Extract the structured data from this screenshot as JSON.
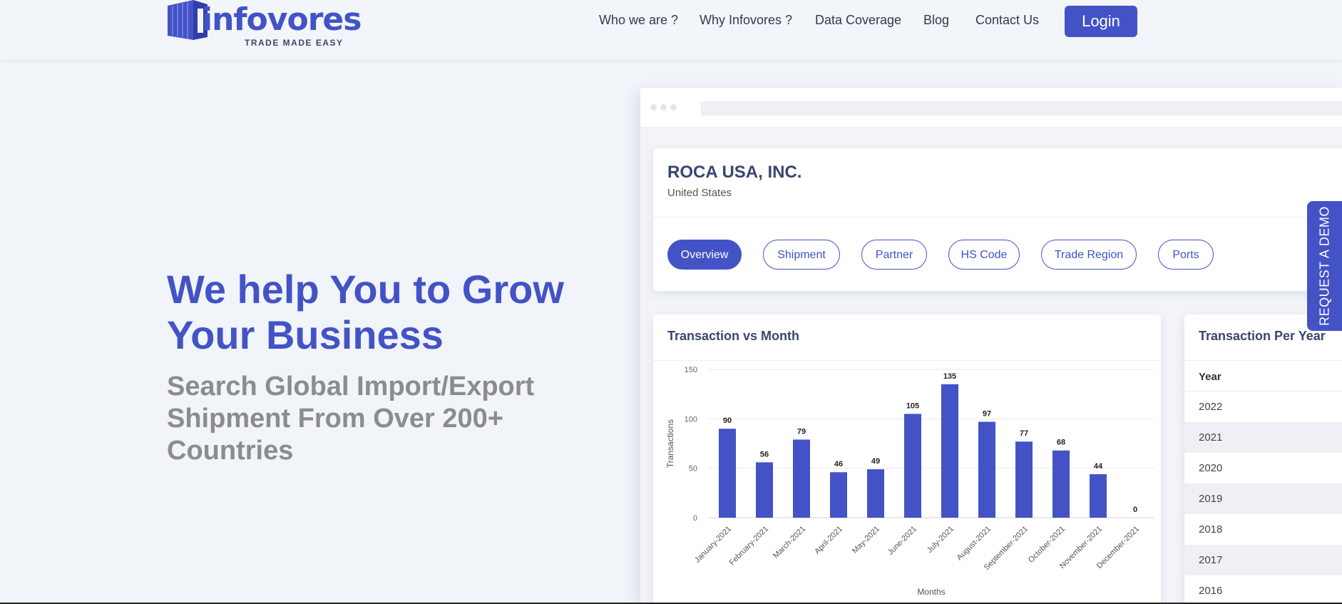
{
  "header": {
    "logo_text": "infovores",
    "logo_tagline": "TRADE MADE EASY",
    "nav": [
      "Who we are ?",
      "Why Infovores ?",
      "Data Coverage",
      "Blog",
      "Contact Us"
    ],
    "login_label": "Login"
  },
  "hero": {
    "title": "We help You to Grow Your Business",
    "subtitle": "Search Global Import/Export Shipment From Over 200+ Countries"
  },
  "company": {
    "name": "ROCA USA, INC.",
    "country": "United States",
    "tabs": [
      "Overview",
      "Shipment",
      "Partner",
      "HS Code",
      "Trade Region",
      "Ports"
    ],
    "active_tab": "Overview"
  },
  "chart_card": {
    "title": "Transaction vs Month"
  },
  "year_card": {
    "title": "Transaction Per Year",
    "column_header": "Year",
    "years": [
      "2022",
      "2021",
      "2020",
      "2019",
      "2018",
      "2017",
      "2016"
    ]
  },
  "demo_tab": {
    "label": "REQUEST A DEMO"
  },
  "colors": {
    "accent": "#4353c6",
    "heading": "#3a4670",
    "subtitle": "#8c8c8c",
    "page_bg": "#f1f4f8"
  },
  "chart_data": {
    "type": "bar",
    "categories": [
      "January-2021",
      "February-2021",
      "March-2021",
      "April-2021",
      "May-2021",
      "June-2021",
      "July-2021",
      "August-2021",
      "September-2021",
      "October-2021",
      "November-2021",
      "December-2021"
    ],
    "values": [
      90,
      56,
      79,
      46,
      49,
      105,
      135,
      97,
      77,
      68,
      44,
      0
    ],
    "xlabel": "Months",
    "ylabel": "Transactions",
    "ylim": [
      0,
      150
    ],
    "yticks": [
      0,
      50,
      100,
      150
    ],
    "grid": true,
    "data_labels": true,
    "color": "#4353c6"
  }
}
